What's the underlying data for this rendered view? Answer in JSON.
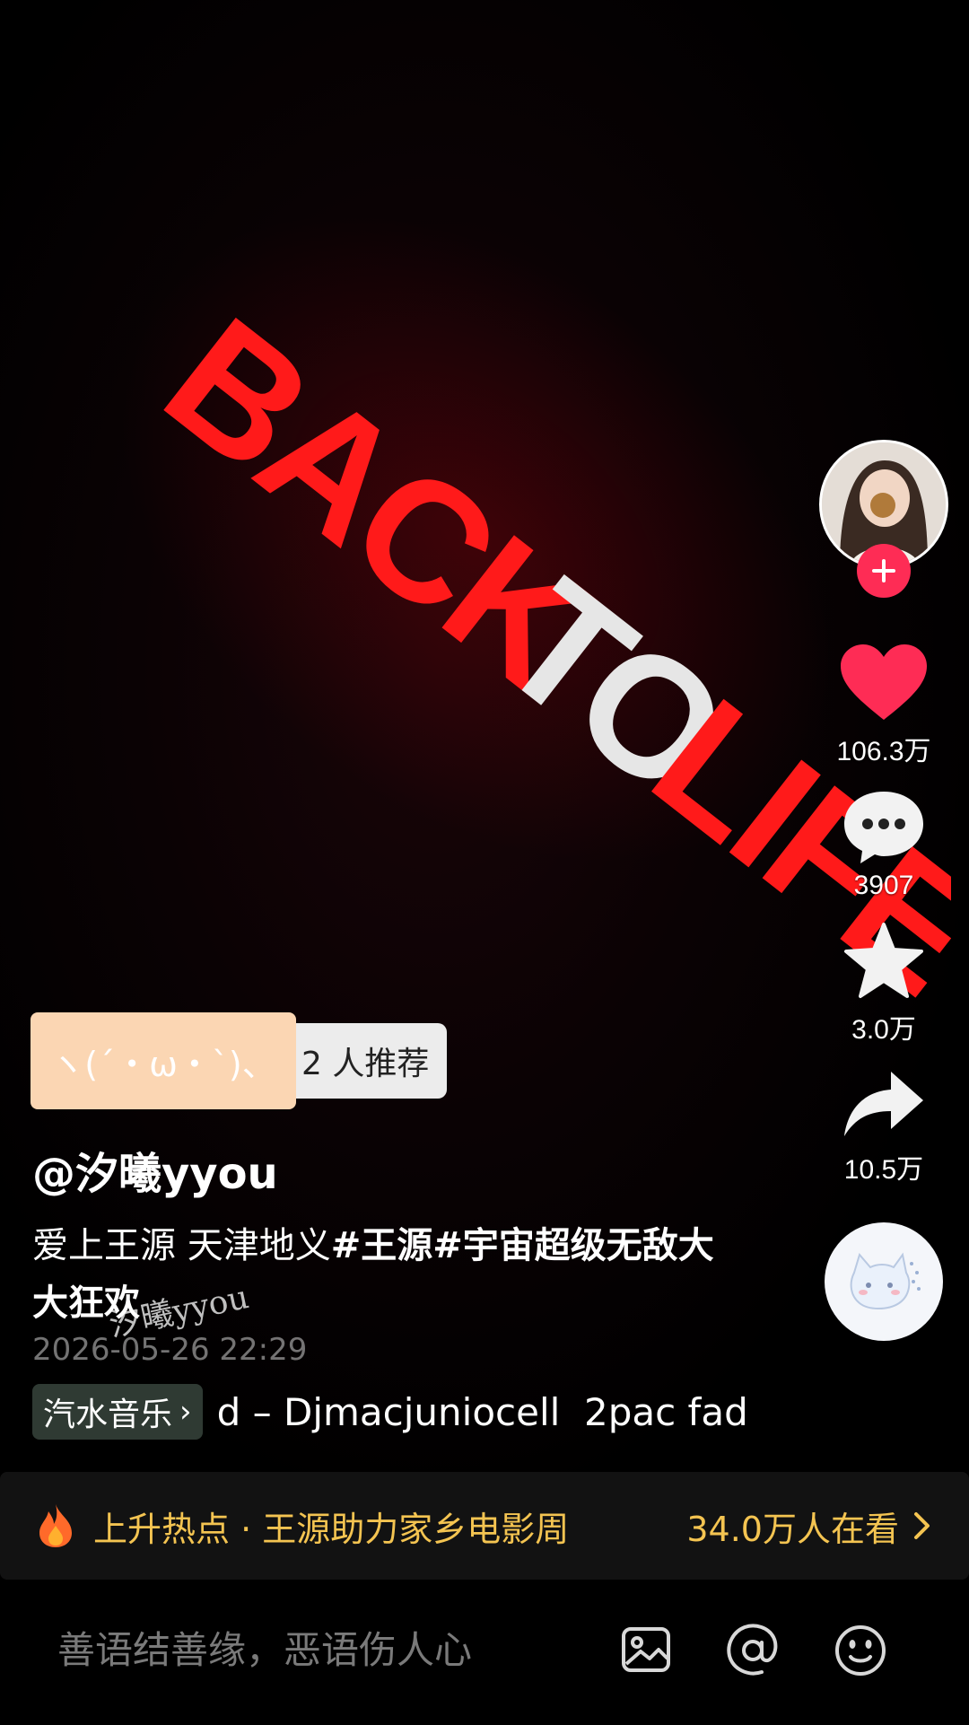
{
  "video": {
    "sign_words": [
      "BACK",
      "TO",
      "LIFE"
    ],
    "colors": {
      "red": "#ff1a1a",
      "white": "#e8e8e8"
    }
  },
  "rail": {
    "avatar": "user-avatar",
    "like_count": "106.3万",
    "comment_count": "3907",
    "favorite_count": "3.0万",
    "share_count": "10.5万",
    "like_color": "#fe2c55"
  },
  "recommend": {
    "kaomoji": "ヽ(´・ω・`)、",
    "label": "2 人推荐"
  },
  "author": "@汐曦yyou",
  "description": {
    "text": "爱上王源 天津地义",
    "tag1": "#王源",
    "tag2": "#宇宙超级无敌大大狂欢"
  },
  "watermark": "汐曦yyou",
  "date": "2026-05-26 22:29",
  "music": {
    "chip": "汽水音乐",
    "title": "d – Djmacjuniocell  2pac fad"
  },
  "hot": {
    "text": "上升热点 · 王源助力家乡电影周",
    "watching": "34.0万人在看",
    "color": "#f4c451"
  },
  "comment": {
    "placeholder": "善语结善缘，恶语伤人心"
  }
}
